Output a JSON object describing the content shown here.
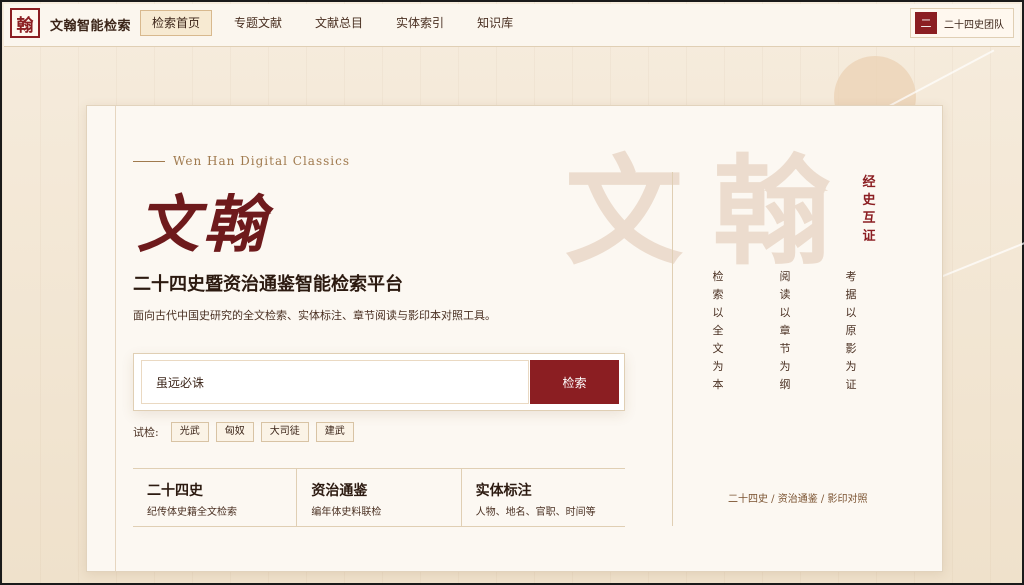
{
  "topbar": {
    "logo_char": "翰",
    "brand": "文翰智能检索",
    "nav": [
      {
        "label": "检索首页",
        "active": true
      },
      {
        "label": "专题文献",
        "active": false
      },
      {
        "label": "文献总目",
        "active": false
      },
      {
        "label": "实体索引",
        "active": false
      },
      {
        "label": "知识库",
        "active": false
      }
    ],
    "team": {
      "badge_char": "二",
      "label": "二十四史团队"
    }
  },
  "hero": {
    "watermark": "文翰",
    "subtitle_en": "Wen Han Digital Classics",
    "title": "文翰",
    "platform_title": "二十四史暨资治通鉴智能检索平台",
    "platform_desc": "面向古代中国史研究的全文检索、实体标注、章节阅读与影印本对照工具。"
  },
  "search": {
    "value": "虽远必诛",
    "button": "检索"
  },
  "try": {
    "label": "试检:",
    "chips": [
      "光武",
      "匈奴",
      "大司徒",
      "建武"
    ]
  },
  "features": [
    {
      "title": "二十四史",
      "desc": "纪传体史籍全文检索"
    },
    {
      "title": "资治通鉴",
      "desc": "编年体史料联检"
    },
    {
      "title": "实体标注",
      "desc": "人物、地名、官职、时间等"
    }
  ],
  "side": {
    "motto": "经史互证",
    "columns": [
      "检索以全文为本",
      "阅读以章节为纲",
      "考据以原影为证"
    ],
    "footer": "二十四史 / 资治通鉴 / 影印对照"
  },
  "colors": {
    "accent": "#8b1e22",
    "background": "#f3e8d6",
    "card": "#fcf8f2"
  }
}
